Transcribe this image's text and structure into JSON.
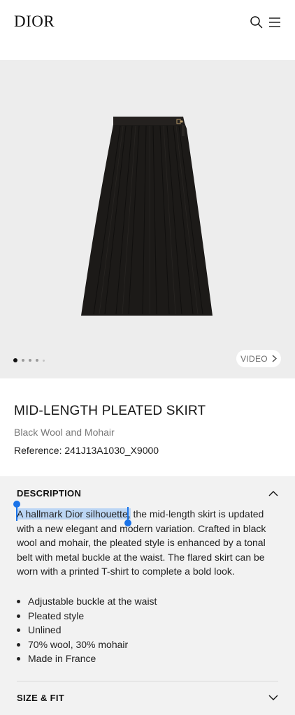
{
  "header": {
    "logo": "DIOR",
    "search_icon": "search-icon",
    "menu_icon": "hamburger-menu-icon"
  },
  "hero": {
    "image": "black pleated skirt product photo",
    "carousel": {
      "slide_count": 5,
      "active_index": 0
    },
    "video_label": "VIDEO"
  },
  "product": {
    "title": "MID-LENGTH PLEATED SKIRT",
    "subtitle": "Black Wool and Mohair",
    "reference": "Reference: 241J13A1030_X9000"
  },
  "description": {
    "heading": "DESCRIPTION",
    "selected_text": "A hallmark Dior silhouette,",
    "body_rest": " the mid-length skirt is updated with a new elegant and modern variation. Crafted in black wool and mohair, the pleated style is enhanced by a tonal belt with metal buckle at the waist. The flared skirt can be worn with a printed T-shirt to complete a bold look.",
    "bullets": [
      "Adjustable buckle at the waist",
      "Pleated style",
      "Unlined",
      "70% wool, 30% mohair",
      "Made in France"
    ]
  },
  "size_fit": {
    "heading": "SIZE & FIT"
  },
  "colors": {
    "selection": "#bcd6f4",
    "selection_handle": "#1a73e8"
  }
}
